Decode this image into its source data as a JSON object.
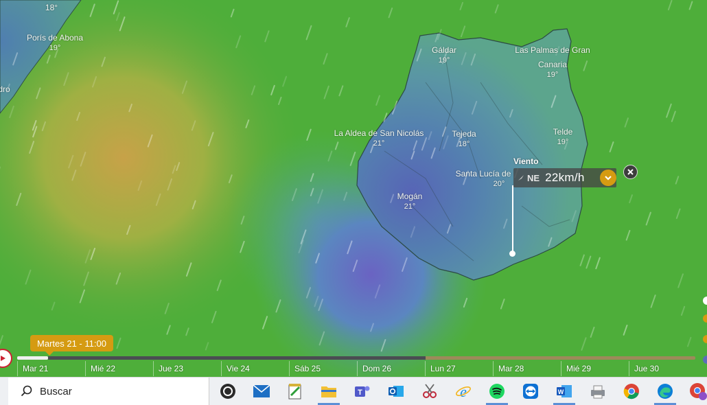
{
  "layer": "Viento",
  "picker": {
    "label": "Viento",
    "direction": "NE",
    "speed": "22km/h"
  },
  "cities": [
    {
      "name": "18°",
      "temp": ""
    },
    {
      "name": "Porís de Abona",
      "temp": "19°"
    },
    {
      "name": "dro",
      "temp": ""
    },
    {
      "name": "Gáldar",
      "temp": "19°"
    },
    {
      "name": "Las Palmas de Gran",
      "temp": ""
    },
    {
      "name": "Canaria",
      "temp": "19°"
    },
    {
      "name": "La Aldea de San Nicolás",
      "temp": "21°"
    },
    {
      "name": "Tejeda",
      "temp": "18°"
    },
    {
      "name": "Telde",
      "temp": "19°"
    },
    {
      "name": "Santa Lucía de",
      "temp": "20°"
    },
    {
      "name": "Mogán",
      "temp": "21°"
    }
  ],
  "timeline": {
    "current": "Martes 21 - 11:00",
    "days": [
      "Mar 21",
      "Mié 22",
      "Jue 23",
      "Vie 24",
      "Sáb 25",
      "Dom 26",
      "Lun 27",
      "Mar 28",
      "Mié 29",
      "Jue 30"
    ]
  },
  "taskbar": {
    "search_label": "Buscar",
    "apps": [
      "obs-icon",
      "mail-icon",
      "notepad-icon",
      "file-explorer-icon",
      "teams-icon",
      "outlook-icon",
      "snipping-icon",
      "internet-explorer-icon",
      "spotify-icon",
      "teamviewer-icon",
      "word-icon",
      "scanner-icon",
      "chrome-icon",
      "edge-icon",
      "chrome-profile-icon"
    ]
  },
  "colors": {
    "accent": "#d59b12",
    "sea_green": "#4fae3c",
    "island_blue": "#5a72b8"
  }
}
